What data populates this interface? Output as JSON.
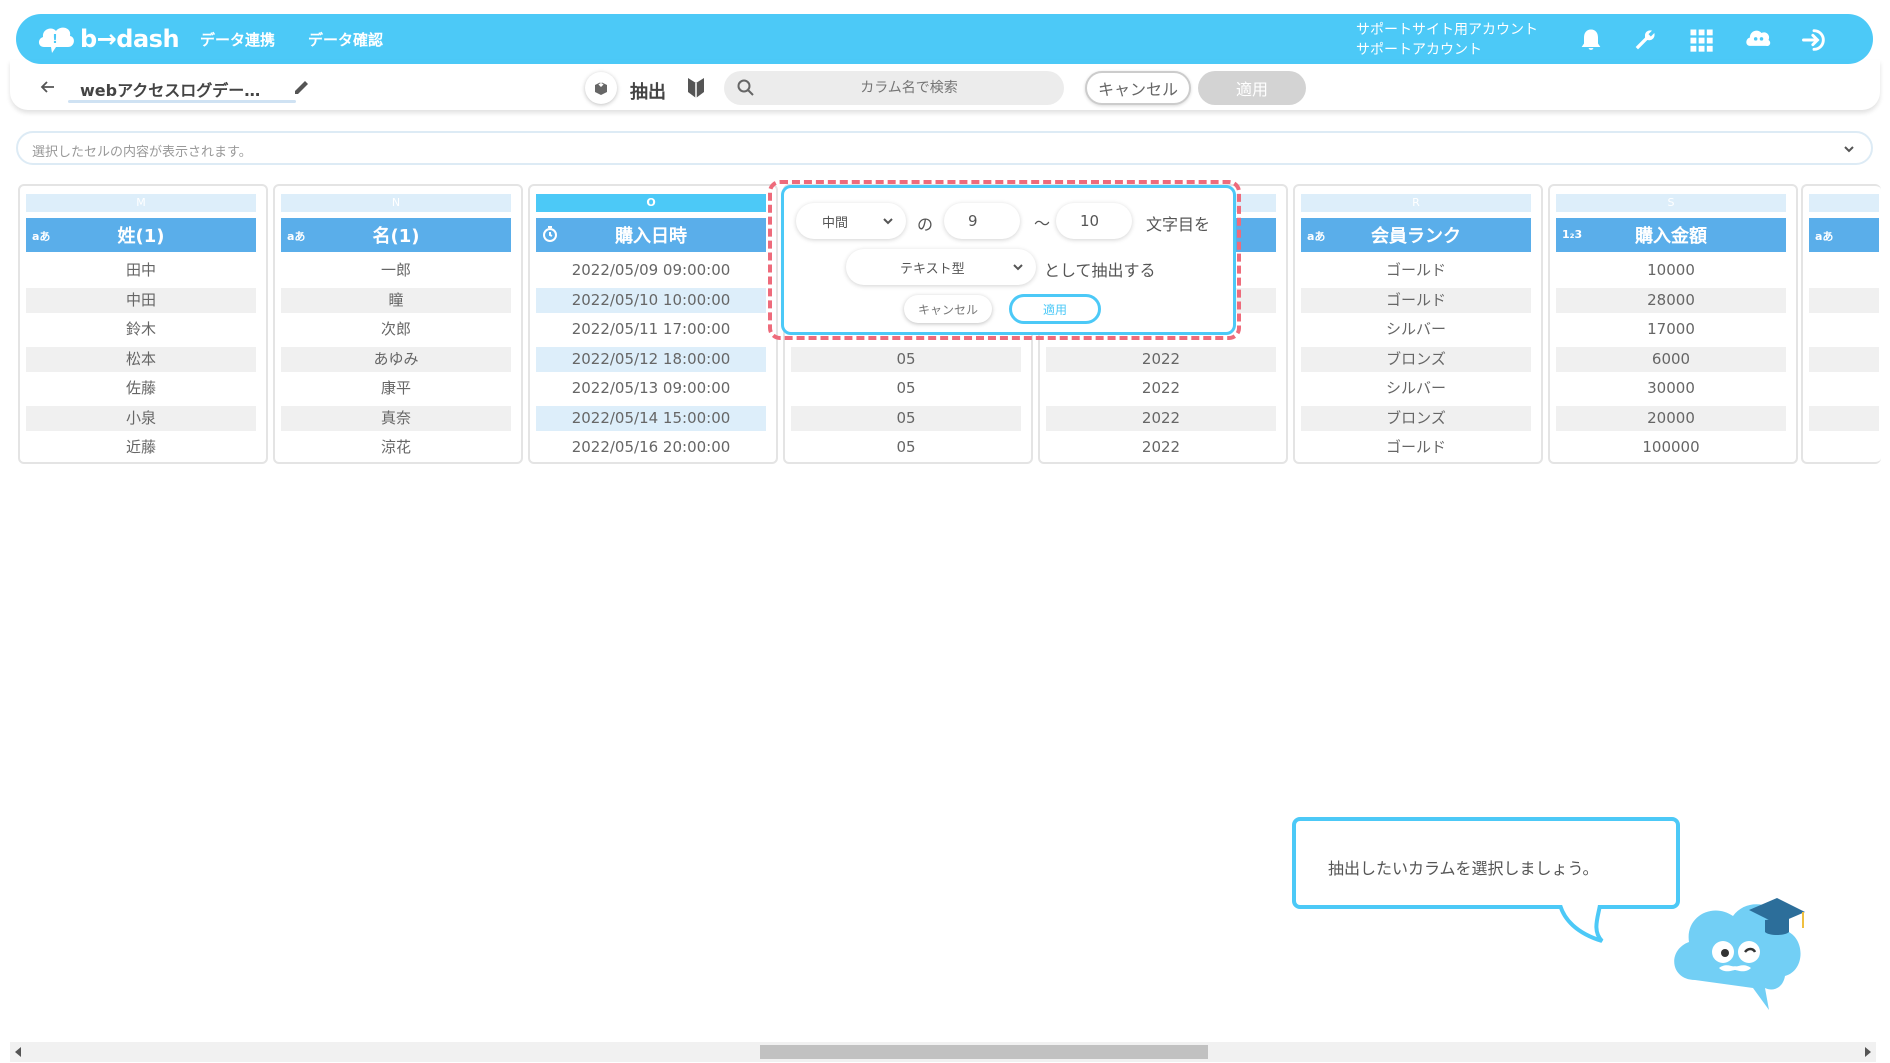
{
  "header": {
    "logo_text": "b→dash",
    "nav": [
      "データ連携",
      "データ確認"
    ],
    "account_line1": "サポートサイト用アカウント",
    "account_line2": "サポートアカウント",
    "icons": [
      "bell-icon",
      "wrench-icon",
      "grid-icon",
      "mascot-icon",
      "logout-icon"
    ],
    "brand_color": "#4cc9f7"
  },
  "toolbar": {
    "file_title": "webアクセスログデー…",
    "mode_label": "抽出",
    "search_placeholder": "カラム名で検索",
    "cancel_label": "キャンセル",
    "apply_label": "適用"
  },
  "cell_bar": {
    "placeholder": "選択したセルの内容が表示されます。"
  },
  "columns": [
    {
      "letter": "M",
      "type": "aあ",
      "name": "姓(1)",
      "cells": [
        "田中",
        "中田",
        "鈴木",
        "松本",
        "佐藤",
        "小泉",
        "近藤"
      ]
    },
    {
      "letter": "N",
      "type": "aあ",
      "name": "名(1)",
      "cells": [
        "一郎",
        "瞳",
        "次郎",
        "あゆみ",
        "康平",
        "真奈",
        "涼花"
      ]
    },
    {
      "letter": "O",
      "type": "clock",
      "name": "購入日時",
      "cells": [
        "2022/05/09 09:00:00",
        "2022/05/10 10:00:00",
        "2022/05/11 17:00:00",
        "2022/05/12 18:00:00",
        "2022/05/13 09:00:00",
        "2022/05/14 15:00:00",
        "2022/05/16 20:00:00"
      ]
    },
    {
      "letter": "P",
      "type": "",
      "name": "",
      "cells": [
        "",
        "",
        "",
        "05",
        "05",
        "05",
        "05"
      ]
    },
    {
      "letter": "Q",
      "type": "",
      "name": "",
      "cells": [
        "",
        "",
        "",
        "2022",
        "2022",
        "2022",
        "2022"
      ]
    },
    {
      "letter": "R",
      "type": "aあ",
      "name": "会員ランク",
      "cells": [
        "ゴールド",
        "ゴールド",
        "シルバー",
        "ブロンズ",
        "シルバー",
        "ブロンズ",
        "ゴールド"
      ]
    },
    {
      "letter": "S",
      "type": "1₂3",
      "name": "購入金額",
      "cells": [
        "10000",
        "28000",
        "17000",
        "6000",
        "30000",
        "20000",
        "100000"
      ]
    },
    {
      "letter": "",
      "type": "aあ",
      "name": "",
      "cells": [
        "",
        "",
        "",
        "",
        "",
        "",
        ""
      ]
    }
  ],
  "popup": {
    "position_select": "中間",
    "of_label": "の",
    "from": "9",
    "tilde": "～",
    "to": "10",
    "char_label": "文字目を",
    "type_select": "テキスト型",
    "as_label": "として抽出する",
    "cancel_label": "キャンセル",
    "apply_label": "適用"
  },
  "tutorial": {
    "message": "抽出したいカラムを選択しましょう。"
  }
}
